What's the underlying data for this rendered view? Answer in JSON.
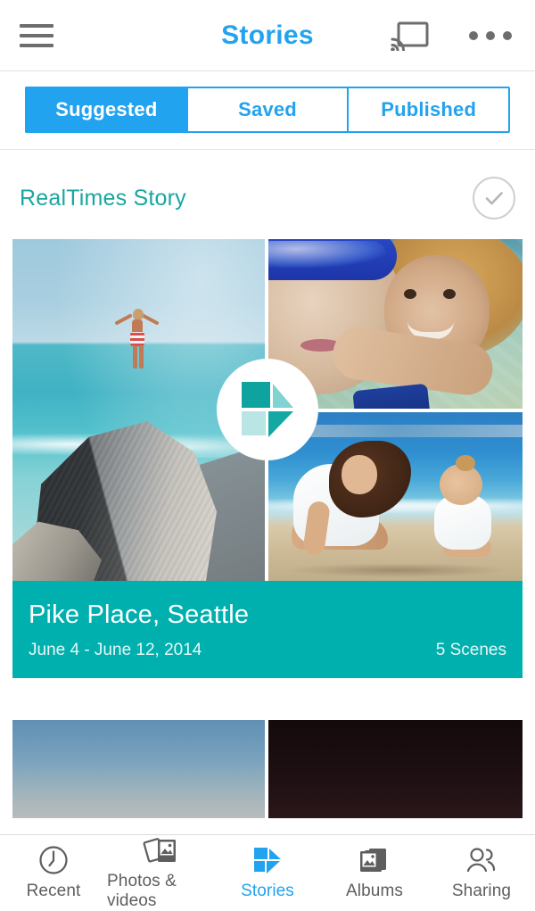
{
  "appbar": {
    "title": "Stories",
    "menu_icon": "hamburger-menu-icon",
    "cast_icon": "cast-icon",
    "overflow_icon": "overflow-menu-icon",
    "title_color": "#22a3ef"
  },
  "tabs": {
    "items": [
      {
        "label": "Suggested",
        "active": true
      },
      {
        "label": "Saved",
        "active": false
      },
      {
        "label": "Published",
        "active": false
      }
    ],
    "accent_color": "#22a3ef"
  },
  "story_section": {
    "heading": "RealTimes Story",
    "heading_color": "#18a6a0",
    "select_icon": "check-circle-icon"
  },
  "story_card": {
    "play_icon": "play-triangle-icon",
    "title": "Pike Place, Seattle",
    "date_range": "June 4 - June 12, 2014",
    "scene_count": "5 Scenes",
    "caption_color": "#00b0ae",
    "photos": [
      {
        "name": "photo-girl-on-rock-beach"
      },
      {
        "name": "photo-kids-underwater"
      },
      {
        "name": "photo-mother-and-toddler-beach"
      }
    ]
  },
  "next_card": {
    "photos": [
      {
        "name": "photo-blue-sky-gradient"
      },
      {
        "name": "photo-dark-night-scene"
      }
    ]
  },
  "bottomnav": {
    "items": [
      {
        "label": "Recent",
        "icon": "clock-icon",
        "active": false
      },
      {
        "label": "Photos & videos",
        "icon": "photo-stack-icon",
        "active": false
      },
      {
        "label": "Stories",
        "icon": "stories-play-icon",
        "active": true
      },
      {
        "label": "Albums",
        "icon": "albums-icon",
        "active": false
      },
      {
        "label": "Sharing",
        "icon": "people-icon",
        "active": false
      }
    ],
    "active_color": "#22a3ef"
  }
}
